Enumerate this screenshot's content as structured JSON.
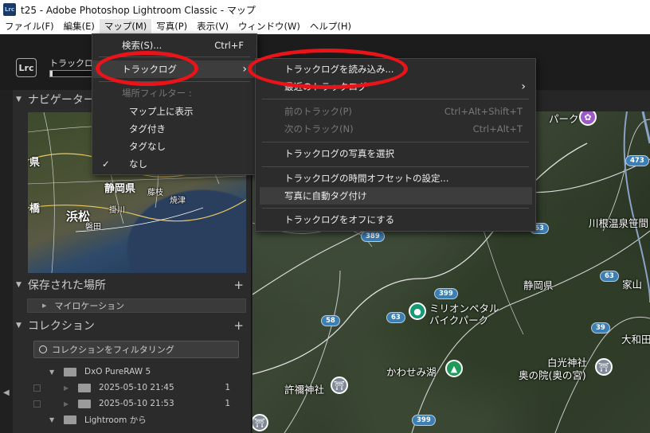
{
  "window": {
    "title": "t25 - Adobe Photoshop Lightroom Classic - マップ",
    "app_icon": "Lrc"
  },
  "menubar": [
    {
      "label": "ファイル(F)"
    },
    {
      "label": "編集(E)"
    },
    {
      "label": "マップ(M)"
    },
    {
      "label": "写真(P)"
    },
    {
      "label": "表示(V)"
    },
    {
      "label": "ウィンドウ(W)"
    },
    {
      "label": "ヘルプ(H)"
    }
  ],
  "identity": {
    "badge": "Lrc",
    "status": "トラックログ",
    "progress_fraction": 0.06
  },
  "left_panel": {
    "navigator": "ナビゲーター",
    "nav_map_labels": [
      "県",
      "静岡県",
      "藤枝",
      "焼津",
      "浜松",
      "掛川",
      "磐田",
      "橋"
    ],
    "saved_places": {
      "title": "保存された場所",
      "plus": "+",
      "item": "マイロケーション"
    },
    "collections": {
      "title": "コレクション",
      "plus": "+",
      "filter_placeholder": "コレクションをフィルタリング",
      "items": [
        {
          "label": "DxO PureRAW 5",
          "count": ""
        },
        {
          "label": "2025-05-10 21:45",
          "count": "1"
        },
        {
          "label": "2025-05-10 21:53",
          "count": "1"
        },
        {
          "label": "Lightroom から",
          "count": ""
        }
      ]
    }
  },
  "map_menu": {
    "items": [
      {
        "label": "検索(S)...",
        "shortcut": "Ctrl+F"
      },
      {
        "label": "トラックログ",
        "submenu_arrow": "›"
      },
      {
        "label": "場所フィルター :"
      },
      {
        "label": "マップ上に表示"
      },
      {
        "label": "タグ付き"
      },
      {
        "label": "タグなし"
      },
      {
        "label": "なし",
        "check": "✓"
      }
    ]
  },
  "tracklog_menu": {
    "items": [
      {
        "label": "トラックログを読み込み..."
      },
      {
        "label": "最近のトラックログ",
        "submenu_arrow": "›"
      },
      {
        "label": "前のトラック(P)",
        "shortcut": "Ctrl+Alt+Shift+T"
      },
      {
        "label": "次のトラック(N)",
        "shortcut": "Ctrl+Alt+T"
      },
      {
        "label": "トラックログの写真を選択"
      },
      {
        "label": "トラックログの時間オフセットの設定..."
      },
      {
        "label": "写真に自動タグ付け"
      },
      {
        "label": "トラックログをオフにする"
      }
    ]
  },
  "map": {
    "labels": [
      "パーク",
      "川根温泉笹間",
      "静岡県",
      "家山",
      "ミリオンペタル",
      "バイクパーク",
      "大和田",
      "白光神社",
      "奥の院(奥の宮)",
      "かわせみ湖",
      "許禰神社"
    ],
    "routes": [
      "473",
      "389",
      "63",
      "399",
      "58",
      "63",
      "39",
      "399"
    ]
  },
  "colors": {
    "highlight_ring": "#e8141a",
    "menu_bg": "#2c2c2c",
    "route_shield": "#3c7fb5"
  }
}
